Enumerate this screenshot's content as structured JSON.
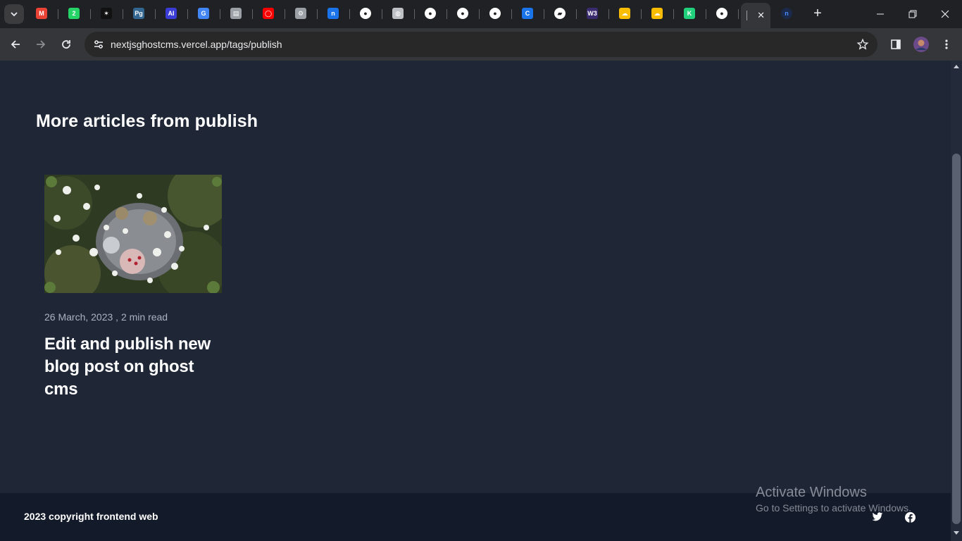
{
  "browser": {
    "tabs": [
      {
        "name": "gmail",
        "color": "#ea4335",
        "glyph": "M"
      },
      {
        "name": "whatsapp",
        "color": "#25d366",
        "glyph": "2"
      },
      {
        "name": "pinned-app",
        "color": "#111111",
        "glyph": "✶"
      },
      {
        "name": "pg",
        "color": "#336791",
        "glyph": "Pg"
      },
      {
        "name": "ai",
        "color": "#3b3bd6",
        "glyph": "AI"
      },
      {
        "name": "google",
        "color": "#4285f4",
        "glyph": "G"
      },
      {
        "name": "docs",
        "color": "#9aa0a6",
        "glyph": "▤"
      },
      {
        "name": "oracle",
        "color": "#f80000",
        "glyph": "◯"
      },
      {
        "name": "settings",
        "color": "#9aa0a6",
        "glyph": "⚙"
      },
      {
        "name": "n-site",
        "color": "#1a73e8",
        "glyph": "n"
      },
      {
        "name": "github",
        "color": "#ffffff",
        "glyph": "●"
      },
      {
        "name": "globe",
        "color": "#bdc1c6",
        "glyph": "◍"
      },
      {
        "name": "github",
        "color": "#ffffff",
        "glyph": "●"
      },
      {
        "name": "github",
        "color": "#ffffff",
        "glyph": "●"
      },
      {
        "name": "github",
        "color": "#ffffff",
        "glyph": "●"
      },
      {
        "name": "c-site",
        "color": "#1a73e8",
        "glyph": "C"
      },
      {
        "name": "dark-site",
        "color": "#ffffff",
        "glyph": "▰"
      },
      {
        "name": "w3",
        "color": "#3a2a70",
        "glyph": "W3"
      },
      {
        "name": "cloud",
        "color": "#fbbc04",
        "glyph": "☁"
      },
      {
        "name": "cloud",
        "color": "#fbbc04",
        "glyph": "☁"
      },
      {
        "name": "green-app",
        "color": "#21d07a",
        "glyph": "K"
      },
      {
        "name": "github",
        "color": "#ffffff",
        "glyph": "●"
      }
    ],
    "active_tab_close": "✕",
    "last_tab_glyph": "n",
    "new_tab": "+",
    "url": "nextjsghostcms.vercel.app/tags/publish"
  },
  "page": {
    "section_title": "More articles from publish",
    "card": {
      "meta": "26 March, 2023 , 2 min read",
      "title": "Edit and publish new blog post on ghost cms"
    },
    "footer": {
      "copyright": "2023 copyright frontend web"
    }
  },
  "watermark": {
    "line1": "Activate Windows",
    "line2": "Go to Settings to activate Windows."
  }
}
